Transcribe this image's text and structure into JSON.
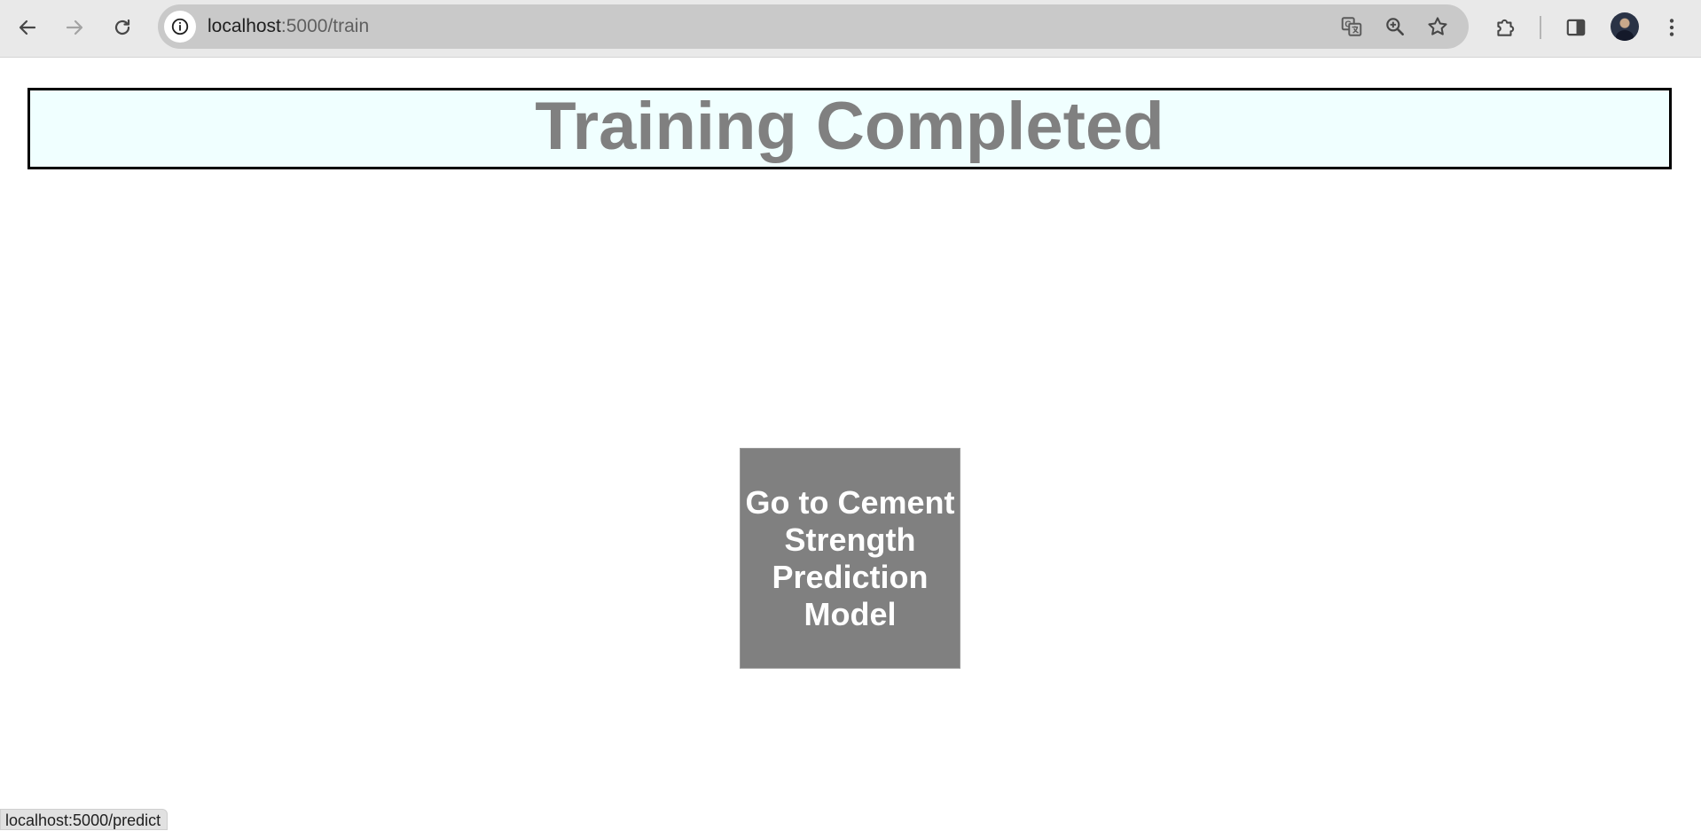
{
  "browser": {
    "url_host": "localhost",
    "url_path": ":5000/train",
    "status_url": "localhost:5000/predict",
    "icons": {
      "back": "back-arrow-icon",
      "forward": "forward-arrow-icon",
      "reload": "reload-icon",
      "site_info": "info-icon",
      "translate": "translate-icon",
      "zoom": "zoom-icon",
      "bookmark": "star-icon",
      "extensions": "puzzle-icon",
      "side_panel": "side-panel-icon",
      "profile": "avatar",
      "menu": "kebab-menu-icon"
    }
  },
  "page": {
    "heading": "Training Completed",
    "cta_label": "Go to Cement Strength Prediction Model",
    "colors": {
      "heading_text": "#808080",
      "heading_bg": "#f0ffff",
      "heading_border": "#000000",
      "button_bg": "#808080",
      "button_text": "#ffffff"
    }
  }
}
